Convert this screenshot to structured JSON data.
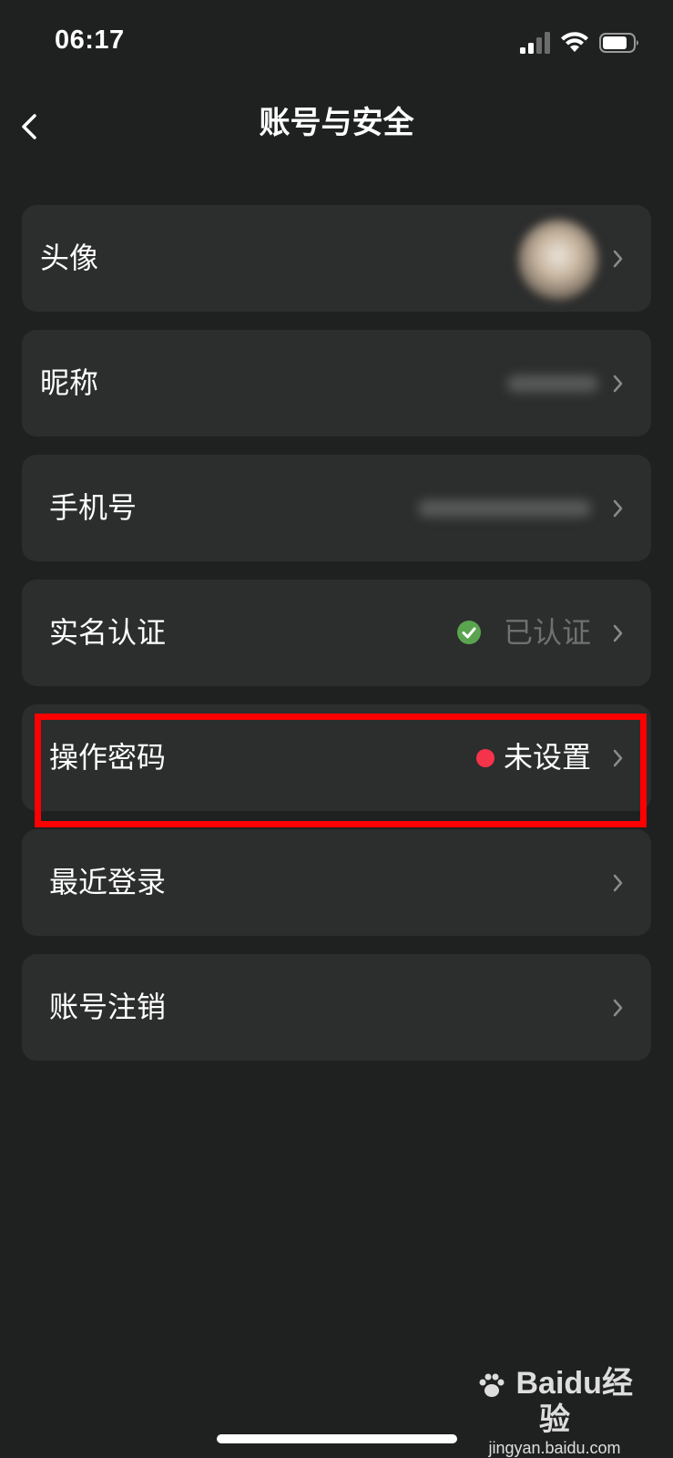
{
  "status_bar": {
    "time": "06:17"
  },
  "header": {
    "title": "账号与安全",
    "back_icon": "chevron-left-icon"
  },
  "settings": {
    "items": [
      {
        "label": "头像",
        "value": ""
      },
      {
        "label": "昵称",
        "value": ""
      },
      {
        "label": "手机号",
        "value": ""
      },
      {
        "label": "实名认证",
        "value": "已认证",
        "status_icon": "check-circle-icon",
        "status_color": "#5aa450"
      },
      {
        "label": "操作密码",
        "value": "未设置",
        "status_icon": "red-dot-icon",
        "status_color": "#f5344b"
      },
      {
        "label": "最近登录",
        "value": ""
      },
      {
        "label": "账号注销",
        "value": ""
      }
    ]
  },
  "watermark": {
    "logo": "Baidu经验",
    "site": "jingyan.baidu.com"
  },
  "colors": {
    "background": "#1f2020",
    "row_background": "#2c2d2d",
    "highlight": "#ff0000"
  }
}
